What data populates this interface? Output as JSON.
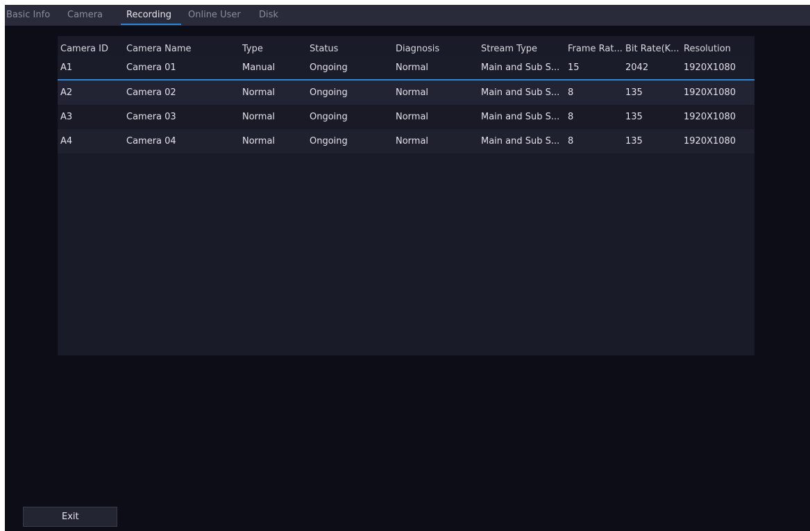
{
  "tabs": [
    {
      "label": "Basic Info"
    },
    {
      "label": "Camera"
    },
    {
      "label": "Recording"
    },
    {
      "label": "Online User"
    },
    {
      "label": "Disk"
    }
  ],
  "active_tab": "Recording",
  "table": {
    "columns": [
      "Camera ID",
      "Camera Name",
      "Type",
      "Status",
      "Diagnosis",
      "Stream Type",
      "Frame Rat...",
      "Bit Rate(K...",
      "Resolution"
    ],
    "rows": [
      [
        "A1",
        "Camera 01",
        "Manual",
        "Ongoing",
        "Normal",
        "Main and Sub S...",
        "15",
        "2042",
        "1920X1080"
      ],
      [
        "A2",
        "Camera 02",
        "Normal",
        "Ongoing",
        "Normal",
        "Main and Sub S...",
        "8",
        "135",
        "1920X1080"
      ],
      [
        "A3",
        "Camera 03",
        "Normal",
        "Ongoing",
        "Normal",
        "Main and Sub S...",
        "8",
        "135",
        "1920X1080"
      ],
      [
        "A4",
        "Camera 04",
        "Normal",
        "Ongoing",
        "Normal",
        "Main and Sub S...",
        "8",
        "135",
        "1920X1080"
      ]
    ],
    "selected_row": 0
  },
  "footer": {
    "exit_label": "Exit"
  },
  "colors": {
    "accent": "#2f86d6",
    "background": "#0d0d18",
    "panel": "#1a1b28",
    "tabbar": "#2a2b3a"
  }
}
